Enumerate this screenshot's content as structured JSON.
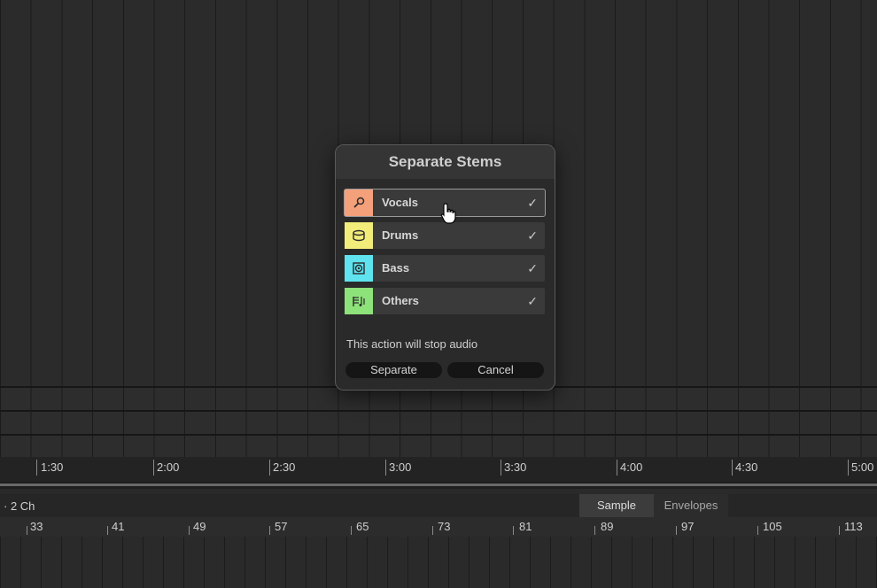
{
  "dialog": {
    "title": "Separate Stems",
    "stems": [
      {
        "label": "Vocals",
        "color": "#f4a07a",
        "icon": "microphone-icon",
        "checked": true,
        "check": "✓"
      },
      {
        "label": "Drums",
        "color": "#f2ec7a",
        "icon": "drum-icon",
        "checked": true,
        "check": "✓"
      },
      {
        "label": "Bass",
        "color": "#5fe3ef",
        "icon": "speaker-icon",
        "checked": true,
        "check": "✓"
      },
      {
        "label": "Others",
        "color": "#8ee27a",
        "icon": "score-icon",
        "checked": true,
        "check": "✓"
      }
    ],
    "warning": "This action will stop audio",
    "separate_label": "Separate",
    "cancel_label": "Cancel"
  },
  "timeline": {
    "labels": [
      "1:30",
      "2:00",
      "2:30",
      "3:00",
      "3:30",
      "4:00",
      "4:30",
      "5:00"
    ]
  },
  "clip_view": {
    "channel_label": "· 2 Ch",
    "tabs": [
      {
        "label": "Sample",
        "active": true
      },
      {
        "label": "Envelopes",
        "active": false
      }
    ],
    "ruler_labels": [
      "33",
      "41",
      "49",
      "57",
      "65",
      "73",
      "81",
      "89",
      "97",
      "105",
      "113"
    ]
  },
  "colors": {
    "dialog_bg": "#2a2a2a",
    "row_bg": "#3a3a3a",
    "button_bg": "#151515"
  }
}
